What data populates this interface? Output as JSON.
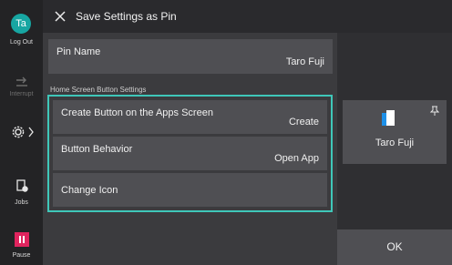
{
  "rail": {
    "avatar_initials": "Ta",
    "logout_label": "Log Out",
    "interrupt_label": "Interrupt",
    "jobs_label": "Jobs",
    "pause_label": "Pause"
  },
  "titlebar": {
    "title": "Save Settings as Pin"
  },
  "pin_name": {
    "label": "Pin Name",
    "value": "Taro Fuji"
  },
  "section": {
    "label": "Home Screen Button Settings"
  },
  "settings": [
    {
      "label": "Create Button on the Apps Screen",
      "value": "Create"
    },
    {
      "label": "Button Behavior",
      "value": "Open App"
    },
    {
      "label": "Change Icon",
      "value": ""
    }
  ],
  "preview": {
    "name": "Taro Fuji"
  },
  "actions": {
    "ok_label": "OK"
  },
  "colors": {
    "accent": "#3fc7b9",
    "avatar": "#17a6a2",
    "pause": "#e0245e"
  }
}
